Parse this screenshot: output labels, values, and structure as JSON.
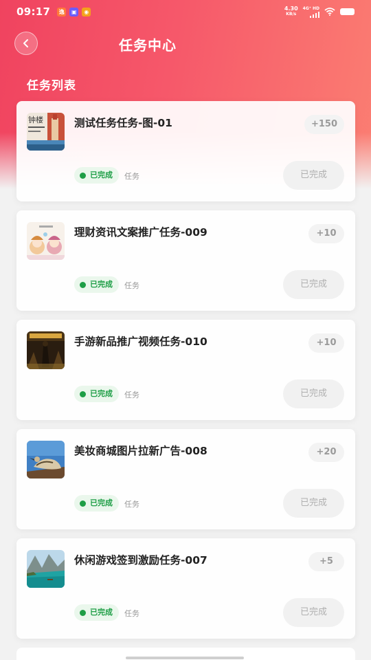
{
  "status_bar": {
    "time": "09:17",
    "net_speed_value": "4.30",
    "net_speed_unit": "KB/s",
    "net_type": "4G⁺ HD"
  },
  "header": {
    "title": "任务中心",
    "section_title": "任务列表"
  },
  "tasks": [
    {
      "title": "测试任务任务-图-01",
      "reward": "+150",
      "status": "已完成",
      "tag": "任务",
      "action": "已完成",
      "thumb": "clock-tower-book-cover"
    },
    {
      "title": "理财资讯文案推广任务-009",
      "reward": "+10",
      "status": "已完成",
      "tag": "任务",
      "action": "已完成",
      "thumb": "anime-girls"
    },
    {
      "title": "手游新品推广视频任务-010",
      "reward": "+10",
      "status": "已完成",
      "tag": "任务",
      "action": "已完成",
      "thumb": "game-poster"
    },
    {
      "title": "美妆商城图片拉新广告-008",
      "reward": "+20",
      "status": "已完成",
      "tag": "任务",
      "action": "已完成",
      "thumb": "bird-photo"
    },
    {
      "title": "休闲游戏签到激励任务-007",
      "reward": "+5",
      "status": "已完成",
      "tag": "任务",
      "action": "已完成",
      "thumb": "lake-mountains"
    }
  ],
  "colors": {
    "header_start": "#f0435f",
    "header_end": "#fb7e72",
    "status_green": "#1e9e46"
  }
}
